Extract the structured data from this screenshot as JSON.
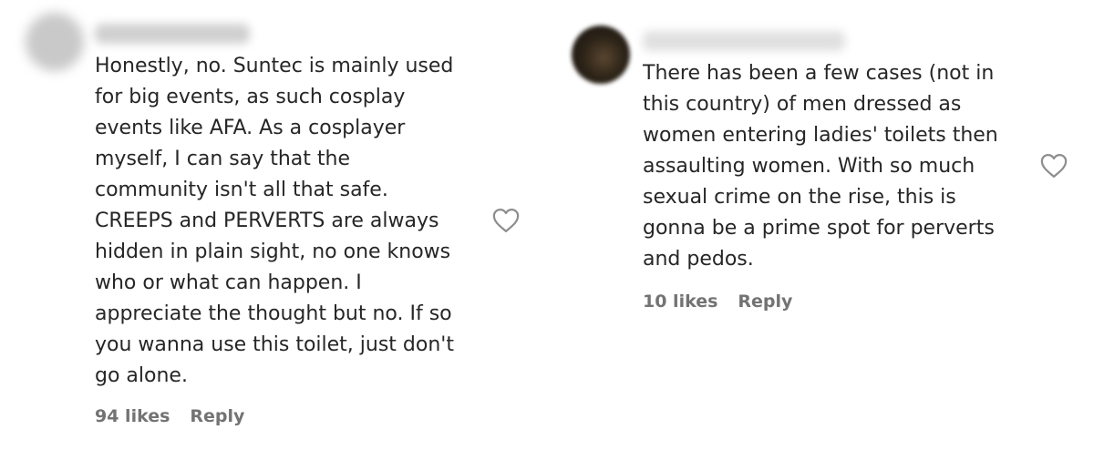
{
  "comments": [
    {
      "text": "Honestly, no. Suntec is mainly used\nfor big events, as such cosplay\nevents like AFA. As a cosplayer\nmyself, I can say that the\ncommunity isn't all that safe.\nCREEPS and PERVERTS are always\nhidden in plain sight, no one knows\nwho or what can happen. I\nappreciate the thought but no. If so\nyou wanna use this toilet, just don't\ngo alone.",
      "likes": "94 likes",
      "reply": "Reply"
    },
    {
      "text": "There has been a few cases (not in\nthis country) of men dressed as\nwomen entering ladies' toilets then\nassaulting women. With so much\nsexual crime on the rise, this is\ngonna be a prime spot for perverts\nand pedos.",
      "likes": "10 likes",
      "reply": "Reply"
    }
  ],
  "icons": {
    "like": "heart-outline-icon"
  },
  "colors": {
    "text": "#262626",
    "meta": "#737373",
    "icon": "#8e8e8e"
  }
}
